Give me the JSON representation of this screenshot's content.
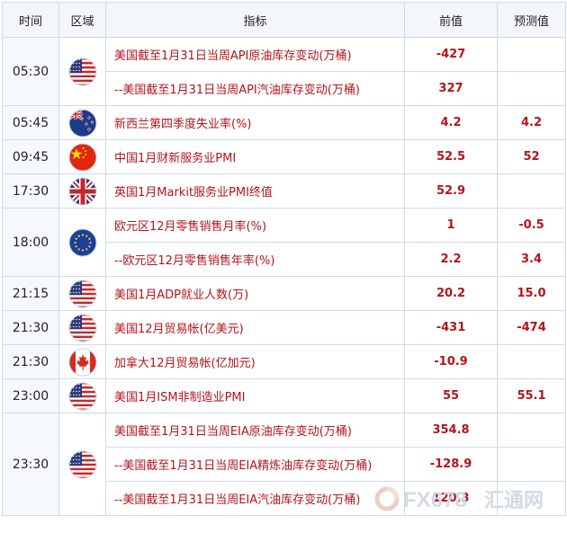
{
  "header": {
    "time": "时间",
    "region": "区域",
    "indicator": "指标",
    "previous": "前值",
    "forecast": "预测值"
  },
  "rows": [
    {
      "time": "05:30",
      "flag": "us-flag-icon",
      "events": [
        {
          "name": "美国截至1月31日当周API原油库存变动(万桶)",
          "prev": "-427",
          "fc": ""
        },
        {
          "name": "--美国截至1月31日当周API汽油库存变动(万桶)",
          "prev": "327",
          "fc": ""
        }
      ]
    },
    {
      "time": "05:45",
      "flag": "nz-flag-icon",
      "events": [
        {
          "name": "新西兰第四季度失业率(%)",
          "prev": "4.2",
          "fc": "4.2"
        }
      ]
    },
    {
      "time": "09:45",
      "flag": "cn-flag-icon",
      "events": [
        {
          "name": "中国1月财新服务业PMI",
          "prev": "52.5",
          "fc": "52"
        }
      ]
    },
    {
      "time": "17:30",
      "flag": "uk-flag-icon",
      "events": [
        {
          "name": "英国1月Markit服务业PMI终值",
          "prev": "52.9",
          "fc": ""
        }
      ]
    },
    {
      "time": "18:00",
      "flag": "eu-flag-icon",
      "events": [
        {
          "name": "欧元区12月零售销售月率(%)",
          "prev": "1",
          "fc": "-0.5"
        },
        {
          "name": "--欧元区12月零售销售年率(%)",
          "prev": "2.2",
          "fc": "3.4"
        }
      ]
    },
    {
      "time": "21:15",
      "flag": "us-flag-icon",
      "events": [
        {
          "name": "美国1月ADP就业人数(万)",
          "prev": "20.2",
          "fc": "15.0"
        }
      ]
    },
    {
      "time": "21:30",
      "flag": "us-flag-icon",
      "events": [
        {
          "name": "美国12月贸易帐(亿美元)",
          "prev": "-431",
          "fc": "-474"
        }
      ]
    },
    {
      "time": "21:30",
      "flag": "ca-flag-icon",
      "events": [
        {
          "name": "加拿大12月贸易帐(亿加元)",
          "prev": "-10.9",
          "fc": ""
        }
      ]
    },
    {
      "time": "23:00",
      "flag": "us-flag-icon",
      "events": [
        {
          "name": "美国1月ISM非制造业PMI",
          "prev": "55",
          "fc": "55.1"
        }
      ]
    },
    {
      "time": "23:30",
      "flag": "us-flag-icon",
      "events": [
        {
          "name": "美国截至1月31日当周EIA原油库存变动(万桶)",
          "prev": "354.8",
          "fc": ""
        },
        {
          "name": "--美国截至1月31日当周EIA精炼油库存变动(万桶)",
          "prev": "-128.9",
          "fc": ""
        },
        {
          "name": "--美国截至1月31日当周EIA汽油库存变动(万桶)",
          "prev": "120.3",
          "fc": ""
        }
      ]
    }
  ],
  "watermark": {
    "brand": "FX678",
    "name": "汇通网"
  }
}
